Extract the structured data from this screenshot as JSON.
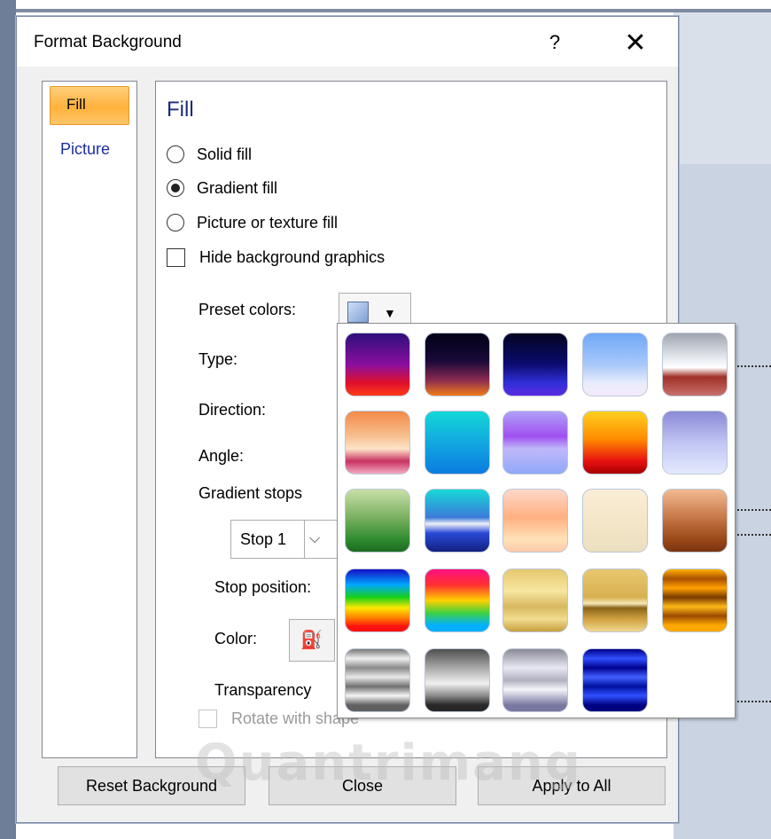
{
  "dialog": {
    "title": "Format Background",
    "help": "?",
    "close": "✕"
  },
  "nav": {
    "fill": "Fill",
    "picture": "Picture"
  },
  "fill": {
    "heading": "Fill",
    "solid_fill": "Solid fill",
    "gradient_fill": "Gradient fill",
    "picture_texture_fill": "Picture or texture fill",
    "hide_background": "Hide background graphics",
    "selected_option": "Gradient fill",
    "preset_colors_label": "Preset colors:",
    "type_label": "Type:",
    "direction_label": "Direction:",
    "angle_label": "Angle:",
    "gradient_stops_label": "Gradient stops",
    "stop_select_value": "Stop 1",
    "stop_position_label": "Stop position:",
    "color_label": "Color:",
    "transparency_label": "Transparency",
    "rotate_label": "Rotate with shape"
  },
  "buttons": {
    "reset": "Reset Background",
    "close": "Close",
    "apply_all": "Apply to All"
  },
  "presets": {
    "gradients": [
      "linear-gradient(#2e0f7a, #8a0fa0 50%, #e0102a 80%, #ff3b1a)",
      "linear-gradient(#000018, #1a0a3a 45%, #8a2a50 75%, #f07a1a)",
      "linear-gradient(#03031f, #0b0b72 50%, #3030d8 80%, #5a2ae0)",
      "linear-gradient(#6fa8f7, #a8c8fa 50%, #e8ecfb 80%, #f4eafa)",
      "linear-gradient(#a0a4ae, #e6eaf0 40%, #ffffff 55%, #a03028 70%, #c8706a)",
      "linear-gradient(#f48a48, #f6c090 40%, #ffe4c8 60%, #c83262 80%, #f4aac0)",
      "linear-gradient(#12d8d6, #12a8e0 50%, #0a7be0)",
      "linear-gradient(#b0a0f8, #a050f0 40%, #c0b8fa 60%, #90a8f8)",
      "linear-gradient(#ffd020, #ff8a00 45%, #e81010 80%, #a80000)",
      "linear-gradient(#8a8ad6, #c0c4f4 50%, #e4eaff)",
      "linear-gradient(#c8e0a8, #7ab060 45%, #2f8c30 80%, #1e6a20)",
      "linear-gradient(#18d8d8, #3a7ad8 45%, #f0f0f8 55%, #2a4ad8 70%, #122080)",
      "linear-gradient(#ffd8c8, #ffb080 45%, #ffe2b8 80%, #ffc8a8)",
      "linear-gradient(#fbeed8, #f4e6c8 50%, #ece0c0)",
      "linear-gradient(#f2ba90, #c67848 45%, #9a4818 80%, #7a3410)",
      "linear-gradient(#1410c8, #00a8ff 25%, #18d018 45%, #ffe800 62%, #ff8000 78%, #ff1010 92%)",
      "linear-gradient(#ff1080, #ff3030 25%, #ffd000 50%, #40d040 70%, #00b0ff 90%)",
      "linear-gradient(#e6c870, #f6e6a0 35%, #d8b860 60%, #f0dc90 80%, #c8a040)",
      "linear-gradient(#e8c870, #d8b050 45%, #f6e8b8 55%, #8a6418 62%, #d0a040 80%, #f0d890)",
      "linear-gradient(#ffb000, #a85000 15%, #ffa000 30%, #7a3a00 45%, #ffb818 60%, #9a4a00 75%, #ffa800 90%)",
      "linear-gradient(#787878, #f0f0f0 15%, #8a8a8a 30%, #e8e8e8 45%, #707070 60%, #f4f4f4 75%, #606060 90%)",
      "linear-gradient(#505050, #a8a8a8 30%, #f0f0f0 55%, #8a8a8a 75%, #282828 90%)",
      "linear-gradient(#8a8a98, #e8e8f4 30%, #b0b0c0 50%, #f4f4fa 65%, #7878a0 90%)",
      "linear-gradient(#00008a, #3050ff 15%, #000090 30%, #4060ff 45%, #0010a0 60%, #3050ff 75%, #000080 90%)"
    ]
  },
  "watermark": "Quantrimang"
}
